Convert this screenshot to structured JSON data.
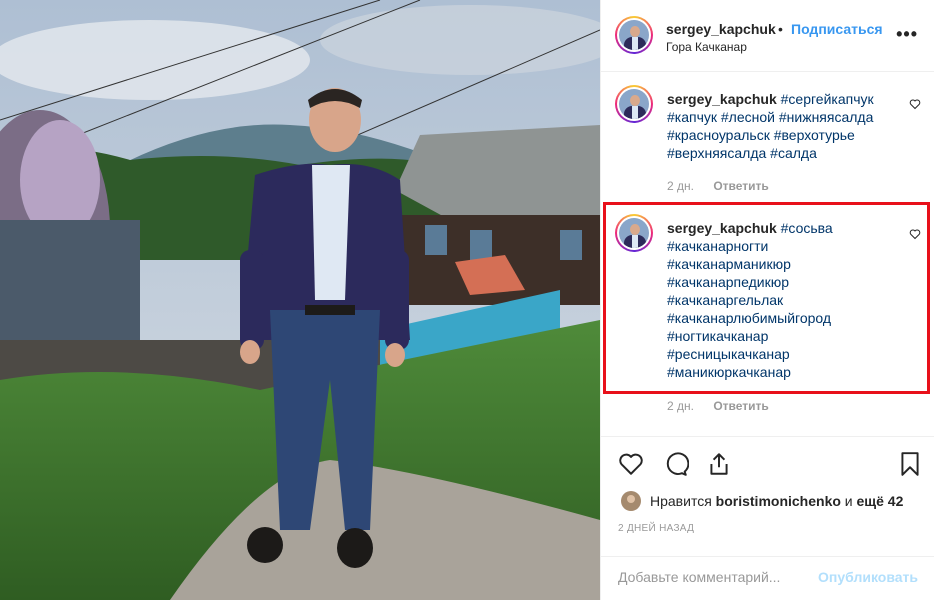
{
  "header": {
    "username": "sergey_kapchuk",
    "separator": "•",
    "follow_label": "Подписаться",
    "location": "Гора Качканар",
    "more_label": "•••"
  },
  "comments": [
    {
      "username": "sergey_kapchuk",
      "lines": [
        "#сергейкапчук",
        "#капчук #лесной #нижняясалда",
        "#красноуральск #верхотурье",
        "#верхняясалда #салда"
      ],
      "age": "2 дн.",
      "reply_label": "Ответить"
    },
    {
      "username": "sergey_kapchuk",
      "lines": [
        "#сосьва",
        "#качканарногти",
        "#качканарманикюр",
        "#качканарпедикюр",
        "#качканаргельлак",
        "#качканарлюбимыйгород",
        "#ногтикачканар",
        "#ресницыкачканар",
        "#маникюркачканар"
      ],
      "age": "2 дн.",
      "reply_label": "Ответить"
    }
  ],
  "likes": {
    "prefix": "Нравится",
    "user": "boristimonichenko",
    "conj": "и",
    "more": "ещё 42"
  },
  "timestamp": "2 ДНЕЙ НАЗАД",
  "add_comment": {
    "placeholder": "Добавьте комментарий...",
    "publish_label": "Опубликовать"
  },
  "colors": {
    "accent": "#3897f0",
    "hashtag": "#003569",
    "highlight": "#e8101a",
    "muted": "#999999"
  }
}
